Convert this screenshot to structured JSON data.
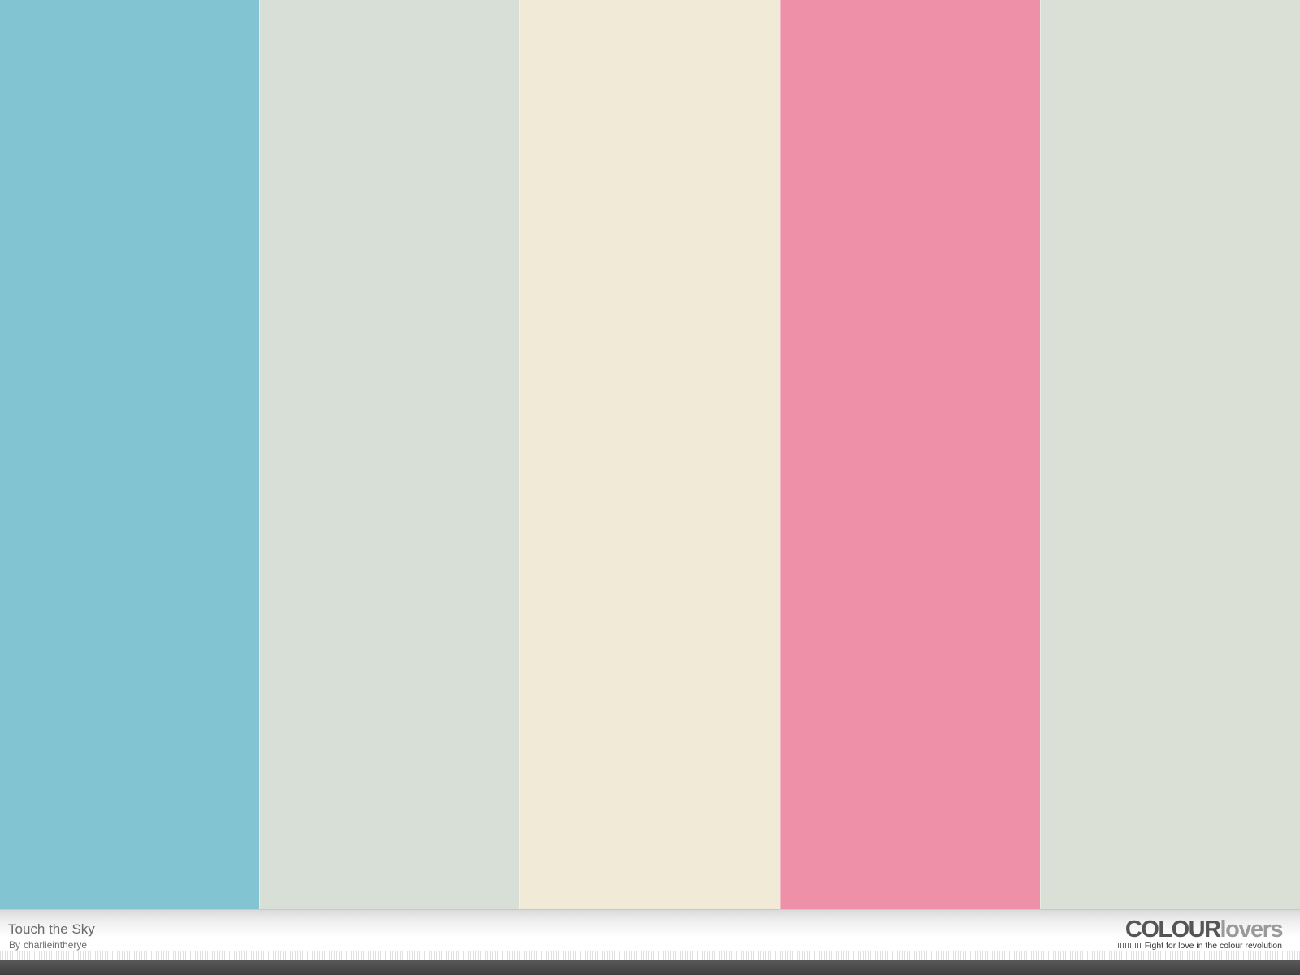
{
  "palette": {
    "title": "Touch the Sky",
    "author_prefix": "By",
    "author": "charlieintherye",
    "colors": [
      "#82C4D2",
      "#D8DFD6",
      "#F0EAD6",
      "#EE90A8",
      "#DAE0D5"
    ]
  },
  "brand": {
    "logo_strong": "COLOUR",
    "logo_light": "lovers",
    "tagline": "Fight for love in the colour revolution"
  }
}
